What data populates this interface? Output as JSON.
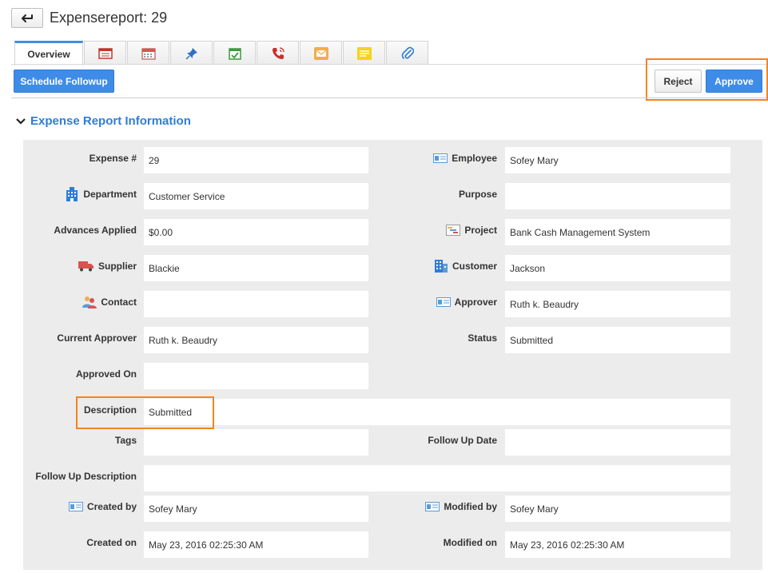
{
  "header": {
    "title": "Expensereport: 29"
  },
  "tabs": [
    {
      "label": "Overview",
      "icon": "overview"
    },
    {
      "icon": "report-icon"
    },
    {
      "icon": "calendar-icon"
    },
    {
      "icon": "pin-icon"
    },
    {
      "icon": "task-icon"
    },
    {
      "icon": "phone-icon"
    },
    {
      "icon": "email-icon"
    },
    {
      "icon": "note-icon"
    },
    {
      "icon": "attachment-icon"
    }
  ],
  "toolbar": {
    "followup_label": "Schedule Followup",
    "reject_label": "Reject",
    "approve_label": "Approve"
  },
  "section": {
    "title": "Expense Report Information"
  },
  "fields": {
    "expense_num": {
      "label": "Expense #",
      "value": "29"
    },
    "employee": {
      "label": "Employee",
      "value": "Sofey Mary"
    },
    "department": {
      "label": "Department",
      "value": "Customer Service"
    },
    "purpose": {
      "label": "Purpose",
      "value": ""
    },
    "advances": {
      "label": "Advances Applied",
      "value": "$0.00"
    },
    "project": {
      "label": "Project",
      "value": "Bank Cash Management System"
    },
    "supplier": {
      "label": "Supplier",
      "value": "Blackie"
    },
    "customer": {
      "label": "Customer",
      "value": "Jackson"
    },
    "contact": {
      "label": "Contact",
      "value": ""
    },
    "approver": {
      "label": "Approver",
      "value": "Ruth k. Beaudry"
    },
    "current_approver": {
      "label": "Current Approver",
      "value": "Ruth k. Beaudry"
    },
    "status": {
      "label": "Status",
      "value": "Submitted"
    },
    "approved_on": {
      "label": "Approved On",
      "value": ""
    },
    "description": {
      "label": "Description",
      "value": "Submitted"
    },
    "tags": {
      "label": "Tags",
      "value": ""
    },
    "follow_up_date": {
      "label": "Follow Up Date",
      "value": ""
    },
    "follow_up_desc": {
      "label": "Follow Up Description",
      "value": ""
    },
    "created_by": {
      "label": "Created by",
      "value": "Sofey Mary"
    },
    "modified_by": {
      "label": "Modified by",
      "value": "Sofey Mary"
    },
    "created_on": {
      "label": "Created on",
      "value": "May 23, 2016 02:25:30 AM"
    },
    "modified_on": {
      "label": "Modified on",
      "value": "May 23, 2016 02:25:30 AM"
    }
  },
  "colors": {
    "accent": "#3e8ce8",
    "highlight": "#f4841f",
    "panel": "#ececec"
  }
}
